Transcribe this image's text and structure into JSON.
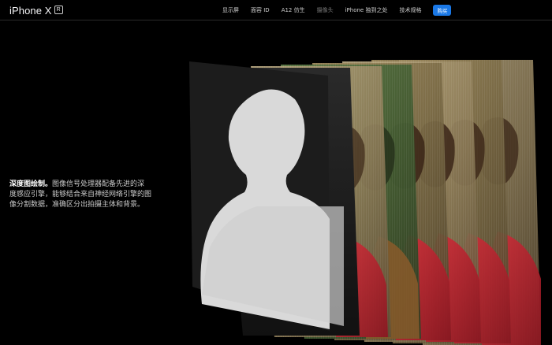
{
  "nav": {
    "brand": "iPhone X",
    "brand_badge": "R",
    "links": [
      {
        "label": "显示屏",
        "active": false
      },
      {
        "label": "面容 ID",
        "active": false
      },
      {
        "label": "A12 仿生",
        "active": false
      },
      {
        "label": "摄像头",
        "active": true
      },
      {
        "label": "iPhone 独到之处",
        "active": false
      },
      {
        "label": "技术规格",
        "active": false
      }
    ],
    "buy_label": "购买"
  },
  "content": {
    "headline": "深度图绘制。",
    "body": "图像信号处理器配备先进的深度感应引擎，能够结合来自神经网络引擎的图像分割数据，准确区分出拍摄主体和背景。"
  },
  "colors": {
    "background": "#000000",
    "accent": "#1a78e6",
    "depth_map": "#d9d9d9",
    "green_layer": "#5c7a46",
    "red_layer": "#b8222d",
    "skin_layer": "#6b4630"
  }
}
